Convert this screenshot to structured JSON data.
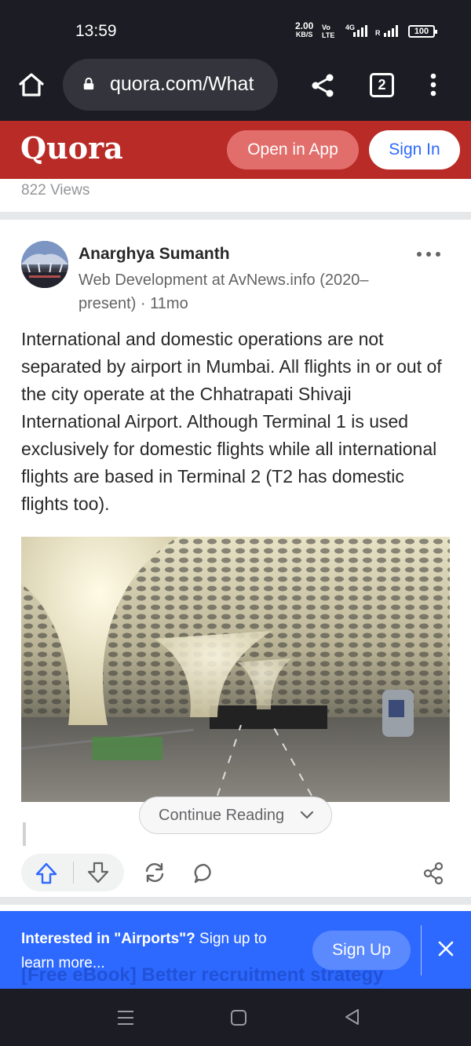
{
  "status_bar": {
    "time": "13:59",
    "net_speed_value": "2.00",
    "net_speed_unit": "KB/S",
    "volte_top": "Vo",
    "volte_bottom": "LTE",
    "network_type": "4G",
    "roaming": "R",
    "battery": "100"
  },
  "browser": {
    "url": "quora.com/What",
    "tab_count": "2"
  },
  "header": {
    "logo": "Quora",
    "open_in_app": "Open in App",
    "sign_in": "Sign In"
  },
  "views": "822 Views",
  "answer": {
    "author": "Anarghya Sumanth",
    "credential": "Web Development at AvNews.info (2020–present) · 11mo",
    "text": "International and domestic operations are not separated by airport in Mumbai. All flights in or out of the city operate at the Chhatrapati Shivaji International Airport. Although Terminal 1 is used exclusively for domestic flights while all international flights are based in Terminal 2 (T2 has domestic flights too).",
    "continue_reading": "Continue Reading"
  },
  "banner": {
    "behind_text": "[Free eBook] Better recruitment strategy",
    "message_bold": "Interested in \"Airports\"?",
    "message_rest": " Sign up to learn more...",
    "sign_up": "Sign Up"
  },
  "icons": {
    "home": "home-icon",
    "lock": "lock-icon",
    "share": "share-icon",
    "menu": "more-vert-icon",
    "upvote": "upvote-arrow-icon",
    "downvote": "downvote-arrow-icon",
    "reshare": "reshare-icon",
    "comment": "comment-icon",
    "close": "close-icon"
  },
  "colors": {
    "quora_red": "#b92b27",
    "accent_blue": "#2e69ff",
    "chrome_dark": "#1c1c24"
  }
}
